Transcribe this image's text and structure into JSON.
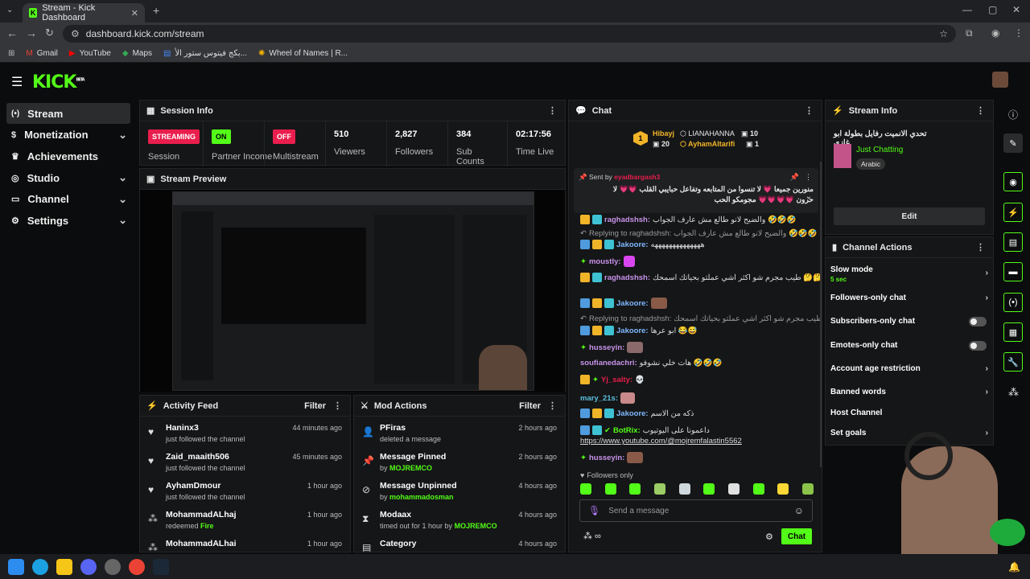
{
  "browser": {
    "tab_title": "Stream - Kick Dashboard",
    "url": "dashboard.kick.com/stream",
    "bookmarks": [
      "Gmail",
      "YouTube",
      "Maps",
      "بكج فيتوس ستور الأ...",
      "Wheel of Names | R..."
    ]
  },
  "app": {
    "logo": "KICK",
    "logo_sup": "BETA"
  },
  "sidebar": {
    "items": [
      {
        "label": "Stream",
        "icon": "broadcast-icon",
        "active": true,
        "chevron": false
      },
      {
        "label": "Monetization",
        "icon": "dollar-icon",
        "chevron": true
      },
      {
        "label": "Achievements",
        "icon": "trophy-icon",
        "chevron": false
      },
      {
        "label": "Studio",
        "icon": "studio-icon",
        "chevron": true
      },
      {
        "label": "Channel",
        "icon": "channel-icon",
        "chevron": true
      },
      {
        "label": "Settings",
        "icon": "gear-icon",
        "chevron": true
      }
    ]
  },
  "session": {
    "title": "Session Info",
    "items": [
      {
        "badge": "STREAMING",
        "label": "Session",
        "color": "#e91e4d"
      },
      {
        "badge": "ON",
        "label": "Partner Income",
        "color": "#53fc18"
      },
      {
        "badge": "OFF",
        "label": "Multistream",
        "color": "#e91e4d"
      }
    ],
    "stats": [
      {
        "value": "510",
        "label": "Viewers"
      },
      {
        "value": "2,827",
        "label": "Followers"
      },
      {
        "value": "384",
        "label": "Sub Counts"
      },
      {
        "value": "02:17:56",
        "label": "Time Live"
      }
    ]
  },
  "preview": {
    "title": "Stream Preview"
  },
  "activity": {
    "title": "Activity Feed",
    "filter": "Filter",
    "items": [
      {
        "name": "Haninx3",
        "detail": "just followed the channel",
        "time": "44 minutes ago",
        "icon": "heart-icon"
      },
      {
        "name": "Zaid_maaith506",
        "detail": "just followed the channel",
        "time": "45 minutes ago",
        "icon": "heart-icon"
      },
      {
        "name": "AyhamDmour",
        "detail": "just followed the channel",
        "time": "1 hour ago",
        "icon": "heart-icon"
      },
      {
        "name": "MohammadALhaj",
        "detail": "redeemed",
        "highlight": "Fire",
        "time": "1 hour ago",
        "icon": "redeem-icon"
      },
      {
        "name": "MohammadALhai",
        "detail": "",
        "time": "1 hour ago",
        "icon": "redeem-icon"
      }
    ]
  },
  "mod": {
    "title": "Mod Actions",
    "filter": "Filter",
    "items": [
      {
        "name": "PFiras",
        "detail": "deleted a message",
        "time": "2 hours ago",
        "icon": "user-icon"
      },
      {
        "name": "Message Pinned",
        "detail": "by",
        "highlight": "MOJREMCO",
        "time": "2 hours ago",
        "icon": "pin-icon"
      },
      {
        "name": "Message Unpinned",
        "detail": "by",
        "highlight": "mohammadosman",
        "time": "4 hours ago",
        "icon": "unpin-icon"
      },
      {
        "name": "Modaax",
        "detail": "timed out for 1 hour by",
        "highlight": "MOJREMCO",
        "time": "4 hours ago",
        "icon": "hourglass-icon"
      },
      {
        "name": "Category",
        "detail": "",
        "time": "4 hours ago",
        "icon": "category-icon"
      }
    ]
  },
  "chat": {
    "title": "Chat",
    "leaders": [
      {
        "rank": "1",
        "name": "Hibayj",
        "count": "20"
      },
      {
        "name": "LIANAHANNA",
        "count": "10"
      },
      {
        "name": "AyhamAltarifi",
        "count": "1"
      }
    ],
    "pinned": {
      "sent_by": "Sent by",
      "user": "eyadbargash3",
      "text": "منورين جميعا 💗 لا تنسوا من المتابعه وتفاعل حبايبي القلب 💗💗 لا حرون 💗💗💗💗 مجومكو الحب"
    },
    "messages": [
      {
        "user": "raghadshsh:",
        "text": "والضيح لانو طالع مش عارف الجواب 🤣🤣🤣",
        "color": "#c792ea"
      },
      {
        "reply": "Replying to raghadshsh: والضيح لانو طالع مش عارف الجواب 🤣🤣🤣"
      },
      {
        "user": "Jakoore:",
        "text": "ههههههههههههههه",
        "color": "#7fb8ff"
      },
      {
        "user": "moustly:",
        "text": "",
        "color": "#c792ea"
      },
      {
        "user": "raghadshsh:",
        "text": "طيب مجرم شو اكثر اشي عملتو بحياتك اسمحك 🤔🤔🤔🤔",
        "color": "#c792ea"
      },
      {
        "user": "Jakoore:",
        "text": "",
        "color": "#7fb8ff"
      },
      {
        "reply": "Replying to raghadshsh: طيب مجرم شو اكثر اشي عملتو بحياتك اسمحك ..."
      },
      {
        "user": "Jakoore:",
        "text": "ابو عرها 😂😅",
        "color": "#7fb8ff"
      },
      {
        "user": "husseyin:",
        "text": "",
        "color": "#c792ea"
      },
      {
        "user": "soufianedachri:",
        "text": "هات خلي نشوفو 🤣🤣🤣",
        "color": "#c792ea"
      },
      {
        "user": "Yj_salty:",
        "text": "💀",
        "color": "#e91e4d"
      },
      {
        "user": "mary_21s:",
        "text": "",
        "color": "#5bc0de"
      },
      {
        "user": "Jakoore:",
        "text": "ذكه من الاسم",
        "color": "#7fb8ff"
      },
      {
        "user": "BotRix:",
        "text": "داعمونا على اليوتيوب",
        "color": "#53fc18"
      },
      {
        "link": "https://www.youtube.com/@mojremfalastin5562"
      },
      {
        "user": "husseyin:",
        "text": "",
        "color": "#c792ea"
      }
    ],
    "followers_only": "Followers only",
    "input_placeholder": "Send a message",
    "send": "Chat"
  },
  "stream_info": {
    "title": "Stream Info",
    "stream_title": "تحدي الانميت رفايل بطولة ابو غازي",
    "category": "Just Chatting",
    "tag": "Arabic",
    "edit": "Edit"
  },
  "channel_actions": {
    "title": "Channel Actions",
    "items": [
      {
        "label": "Slow mode",
        "sub": "5 sec",
        "control": "chevron"
      },
      {
        "label": "Followers-only chat",
        "control": "chevron"
      },
      {
        "label": "Subscribers-only chat",
        "control": "toggle"
      },
      {
        "label": "Emotes-only chat",
        "control": "toggle"
      },
      {
        "label": "Account age restriction",
        "control": "chevron"
      },
      {
        "label": "Banned words",
        "control": "chevron"
      },
      {
        "label": "Host Channel",
        "control": "none"
      },
      {
        "label": "Set goals",
        "control": "chevron"
      }
    ]
  }
}
